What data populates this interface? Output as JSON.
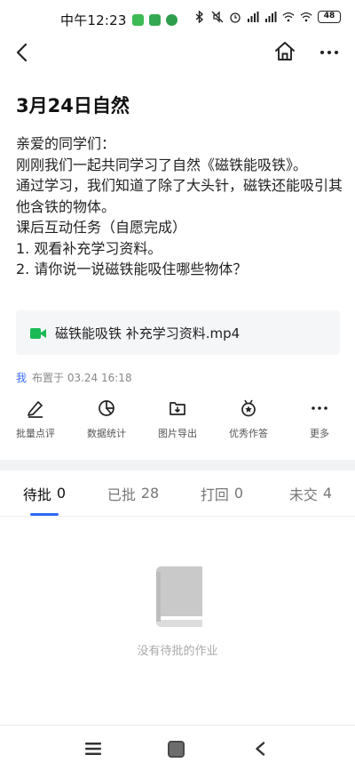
{
  "status_bar": {
    "time": "中午12:23",
    "battery": "48"
  },
  "page": {
    "title": "3月24日自然"
  },
  "content": {
    "lines": [
      "亲爱的同学们：",
      "刚刚我们一起共同学习了自然《磁铁能吸铁》。",
      "通过学习，我们知道了除了大头针，磁铁还能吸引其他含铁的物体。",
      "课后互动任务（自愿完成）",
      "1. 观看补充学习资料。",
      "2. 请你说一说磁铁能吸住哪些物体？"
    ]
  },
  "attachment": {
    "icon": "video-icon",
    "filename": "磁铁能吸铁 补充学习资料.mp4"
  },
  "meta": {
    "author": "我",
    "posted": "布置于 03.24 16:18"
  },
  "toolbar": {
    "items": [
      {
        "label": "批量点评",
        "icon": "pen-icon"
      },
      {
        "label": "数据统计",
        "icon": "pie-chart-icon"
      },
      {
        "label": "图片导出",
        "icon": "download-box-icon"
      },
      {
        "label": "优秀作答",
        "icon": "medal-icon"
      },
      {
        "label": "更多",
        "icon": "more-icon"
      }
    ]
  },
  "tabs": [
    {
      "label": "待批",
      "count": "0",
      "active": true
    },
    {
      "label": "已批",
      "count": "28",
      "active": false
    },
    {
      "label": "打回",
      "count": "0",
      "active": false
    },
    {
      "label": "未交",
      "count": "4",
      "active": false
    }
  ],
  "empty_state": {
    "icon": "book-icon",
    "text": "没有待批的作业"
  },
  "colors": {
    "accent": "#2e6cf6",
    "video_icon": "#19b955"
  }
}
